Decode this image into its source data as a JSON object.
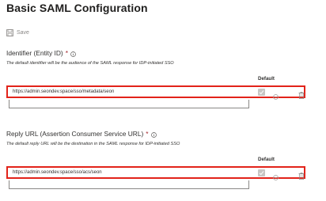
{
  "page": {
    "title": "Basic SAML Configuration"
  },
  "toolbar": {
    "save_label": "Save",
    "save_icon": "save-icon"
  },
  "identifier": {
    "label": "Identifier (Entity ID)",
    "required_mark": "*",
    "description": "The default identifier will be the audience of the SAML response for IDP-initiated SSO",
    "default_header": "Default",
    "rows": [
      {
        "value": "https://admin.seondev.space/sso/metadata/seon",
        "default_checked": true
      }
    ],
    "new_value": ""
  },
  "reply_url": {
    "label": "Reply URL (Assertion Consumer Service URL)",
    "required_mark": "*",
    "description": "The default reply URL will be the destination in the SAML response for IDP-initiated SSO",
    "default_header": "Default",
    "rows": [
      {
        "value": "https://admin.seondev.space/sso/acs/seon",
        "default_checked": true
      }
    ],
    "new_value": ""
  },
  "colors": {
    "highlight_border": "#e2231a",
    "required": "#a4262c",
    "disabled_checkbox": "#c8c6c4"
  }
}
